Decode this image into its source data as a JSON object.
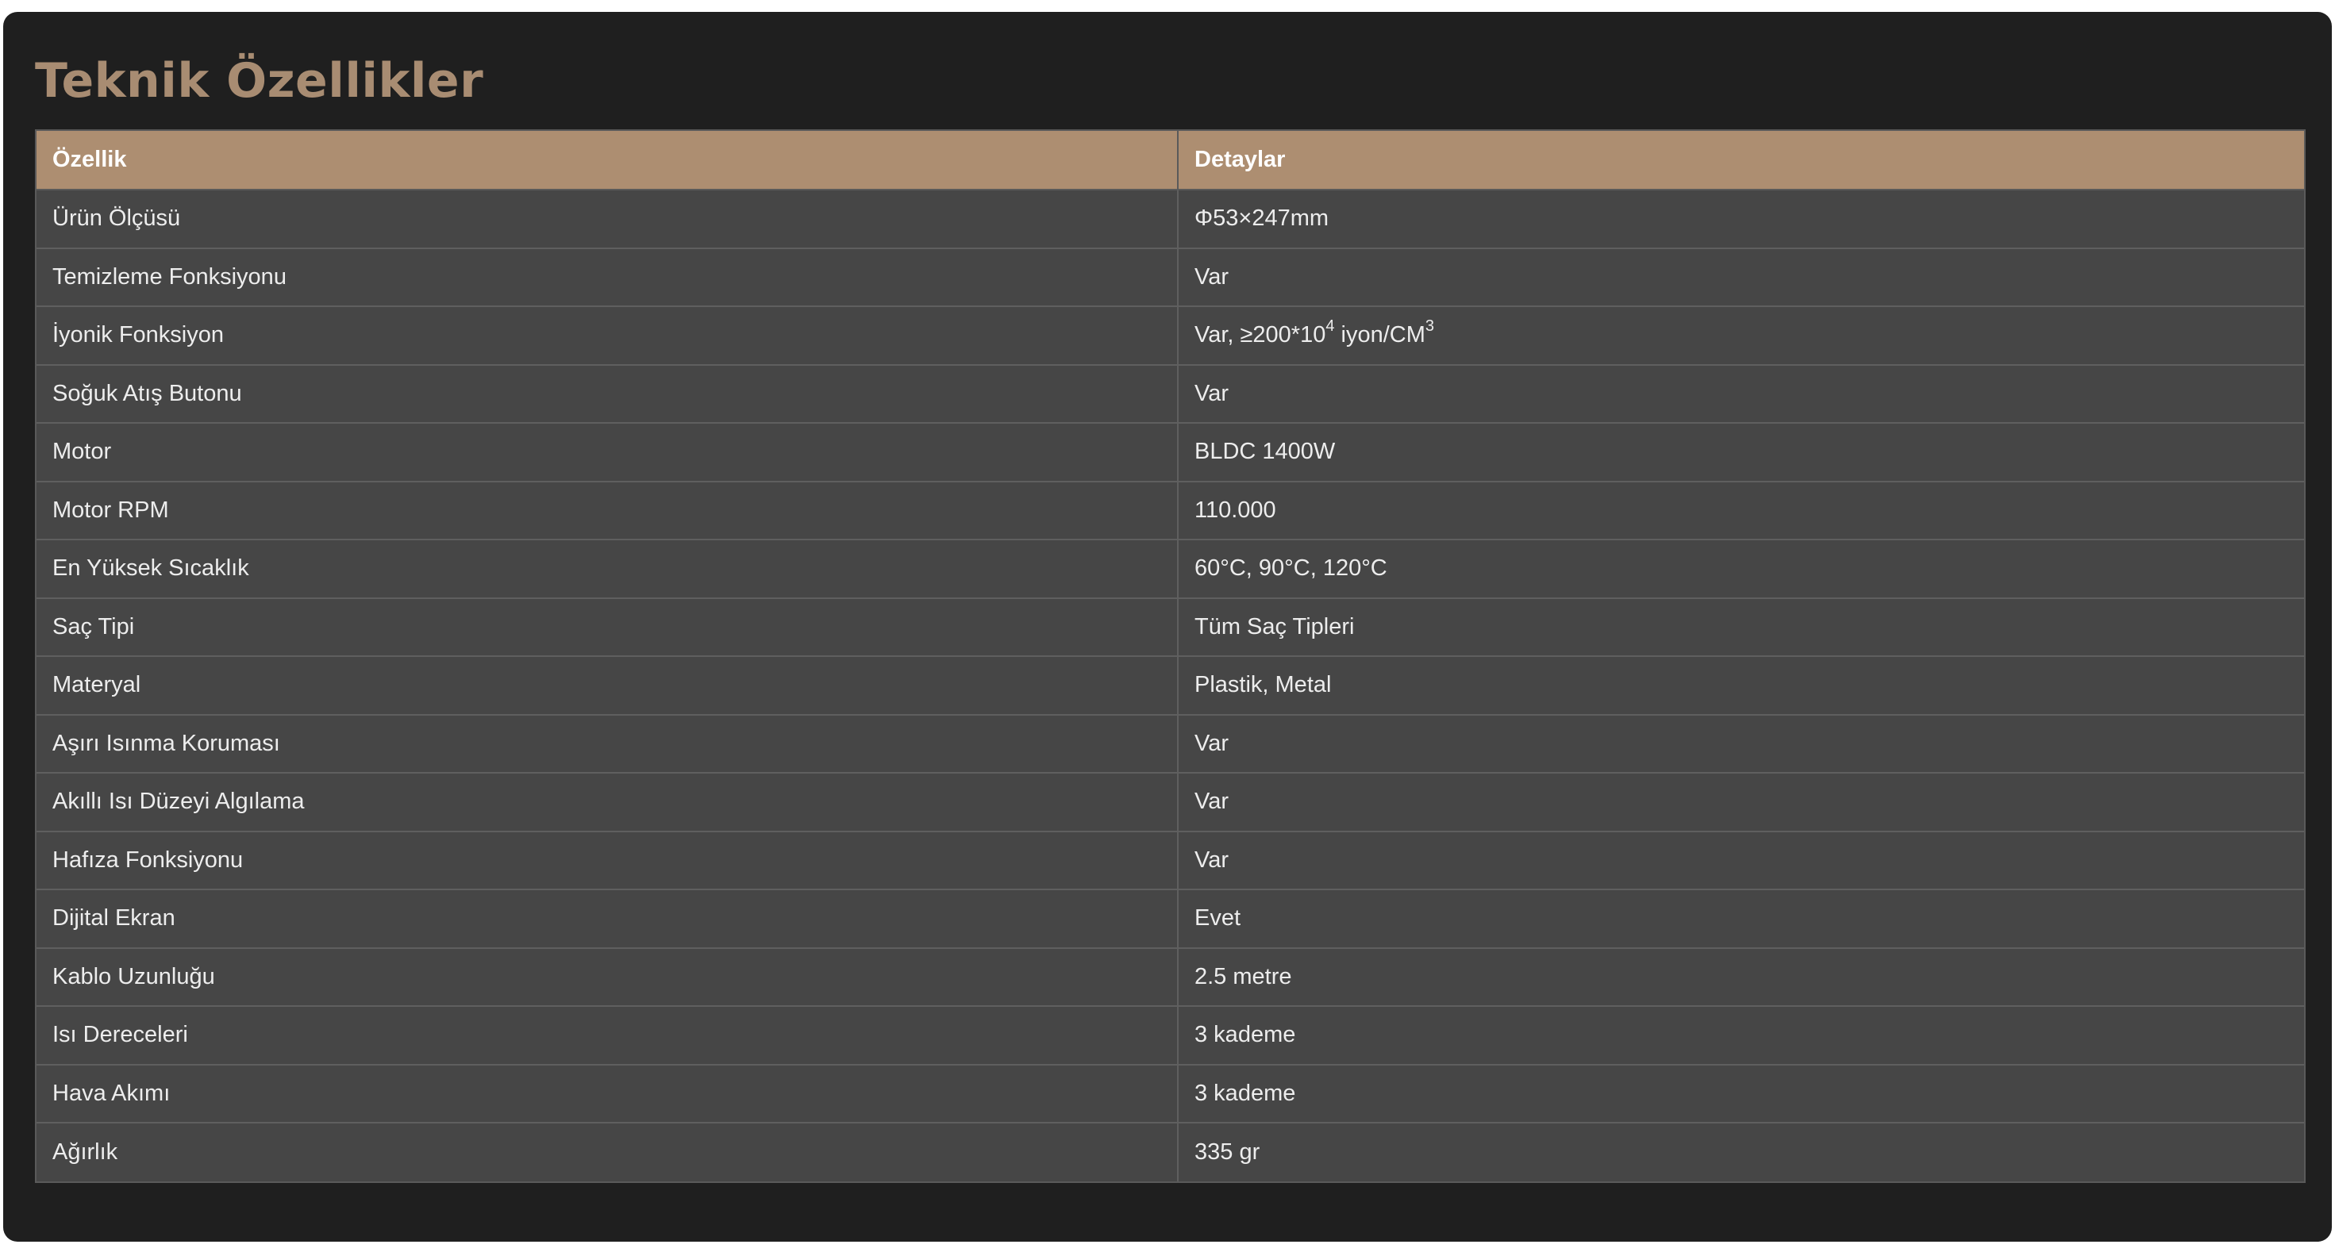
{
  "title": "Teknik Özellikler",
  "table": {
    "headers": [
      "Özellik",
      "Detaylar"
    ],
    "rows": [
      {
        "feature": "Ürün Ölçüsü",
        "detail": "Φ53×247mm"
      },
      {
        "feature": "Temizleme Fonksiyonu",
        "detail": "Var"
      },
      {
        "feature": "İyonik Fonksiyon",
        "detail_parts": [
          "Var, ≥200*10",
          "4",
          " iyon/CM",
          "3"
        ]
      },
      {
        "feature": "Soğuk Atış Butonu",
        "detail": "Var"
      },
      {
        "feature": "Motor",
        "detail": "BLDC 1400W"
      },
      {
        "feature": "Motor RPM",
        "detail": "110.000"
      },
      {
        "feature": "En Yüksek Sıcaklık",
        "detail": "60°C, 90°C, 120°C"
      },
      {
        "feature": "Saç Tipi",
        "detail": "Tüm Saç Tipleri"
      },
      {
        "feature": "Materyal",
        "detail": "Plastik, Metal"
      },
      {
        "feature": "Aşırı Isınma Koruması",
        "detail": "Var"
      },
      {
        "feature": "Akıllı Isı Düzeyi Algılama",
        "detail": "Var"
      },
      {
        "feature": "Hafıza Fonksiyonu",
        "detail": "Var"
      },
      {
        "feature": "Dijital Ekran",
        "detail": "Evet"
      },
      {
        "feature": "Kablo Uzunluğu",
        "detail": "2.5 metre"
      },
      {
        "feature": "Isı Dereceleri",
        "detail": "3 kademe"
      },
      {
        "feature": "Hava Akımı",
        "detail": "3 kademe"
      },
      {
        "feature": "Ağırlık",
        "detail": "335 gr"
      }
    ]
  },
  "colors": {
    "panel_background": "#1f1f1f",
    "title": "#a88c72",
    "header_background": "#ad8e71",
    "row_background": "#464646"
  }
}
